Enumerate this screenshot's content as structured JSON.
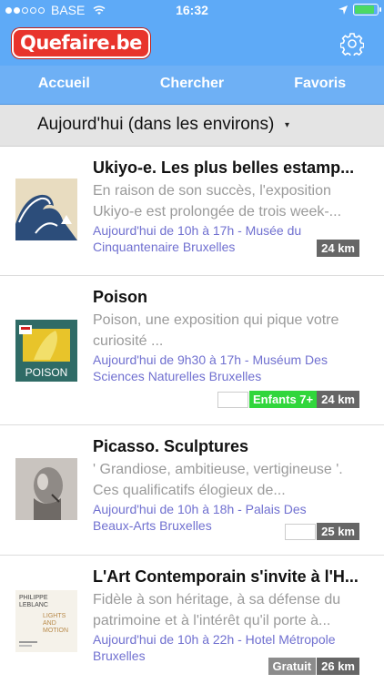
{
  "status_bar": {
    "carrier": "BASE",
    "time": "16:32"
  },
  "header": {
    "logo": "Quefaire.be",
    "settings_icon": "gear-icon"
  },
  "nav": {
    "tabs": [
      {
        "label": "Accueil"
      },
      {
        "label": "Chercher"
      },
      {
        "label": "Favoris"
      }
    ]
  },
  "filter": {
    "selected": "Aujourd'hui (dans les environs)",
    "caret": "▾"
  },
  "events": [
    {
      "title": "Ukiyo-e. Les plus belles estamp...",
      "desc_line1": "En raison de son succès, l'exposition",
      "desc_line2": "Ukiyo-e est prolongée de trois week-...",
      "loc_line1": "Aujourd'hui de 10h à 17h - Musée du",
      "loc_line2": "Cinquantenaire Bruxelles",
      "distance": "24 km"
    },
    {
      "title": "Poison",
      "desc_line1": "Poison, une exposition qui pique votre",
      "desc_line2": "curiosité ...",
      "loc_line1": "Aujourd'hui de 9h30 à 17h - Muséum Des",
      "loc_line2": "Sciences Naturelles Bruxelles",
      "kids_badge": "Enfants 7+",
      "distance": "24 km",
      "thumb_text": "POISON"
    },
    {
      "title": "Picasso. Sculptures",
      "desc_line1": "' Grandiose, ambitieuse, vertigineuse '.",
      "desc_line2": "Ces qualificatifs élogieux de...",
      "loc_line1": "Aujourd'hui de 10h à 18h - Palais Des",
      "loc_line2": "Beaux-Arts Bruxelles",
      "distance": "25 km"
    },
    {
      "title": "L'Art Contemporain s'invite à l'H...",
      "desc_line1": "Fidèle à son héritage, à sa défense du",
      "desc_line2": "patrimoine et à l'intérêt qu'il porte à...",
      "loc_line1": "Aujourd'hui de 10h à 22h - Hotel Métropole",
      "loc_line2": "Bruxelles",
      "free_badge": "Gratuit",
      "distance": "26 km",
      "thumb_line1": "PHILIPPE",
      "thumb_line2": "LEBLANC",
      "thumb_line3": "LIGHTS",
      "thumb_line4": "AND",
      "thumb_line5": "MOTION"
    }
  ],
  "colors": {
    "header_blue": "#5eaaf7",
    "logo_red": "#e8342c",
    "link_purple": "#7070d0",
    "kids_green": "#31d63c"
  }
}
